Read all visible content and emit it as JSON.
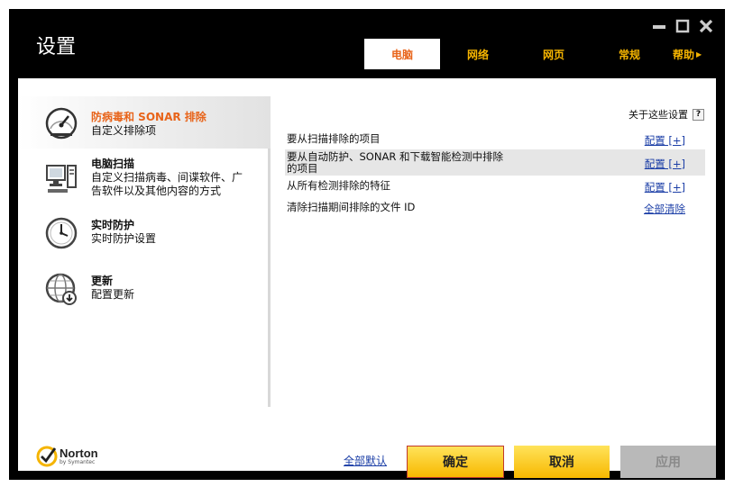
{
  "window": {
    "title": "设置",
    "controls": [
      "minimize-icon",
      "maximize-icon",
      "close-icon"
    ]
  },
  "tabs": [
    {
      "label": "电脑",
      "active": true
    },
    {
      "label": "网络",
      "active": false
    },
    {
      "label": "网页",
      "active": false
    },
    {
      "label": "常规",
      "active": false
    },
    {
      "label": "帮助",
      "active": false
    }
  ],
  "sidebar": {
    "items": [
      {
        "title": "防病毒和 SONAR 排除",
        "desc": "自定义排除项",
        "icon": "gauge-icon",
        "active": true
      },
      {
        "title": "电脑扫描",
        "desc": "自定义扫描病毒、间谍软件、广告软件以及其他内容的方式",
        "desc_line1": "自定义扫描病毒、间谍软件、广",
        "desc_line2": "告软件以及其他内容的方式",
        "icon": "computer-icon",
        "active": false
      },
      {
        "title": "实时防护",
        "desc": "实时防护设置",
        "icon": "clock-icon",
        "active": false
      },
      {
        "title": "更新",
        "desc": "配置更新",
        "icon": "globe-download-icon",
        "active": false
      }
    ]
  },
  "main": {
    "about_label": "关于这些设置",
    "help_label": "?",
    "rows": [
      {
        "label": "要从扫描排除的项目",
        "action": "配置 [+]"
      },
      {
        "label_line1": "要从自动防护、SONAR 和下载智能检测中排除",
        "label_line2": "的项目",
        "action": "配置 [+]"
      },
      {
        "label": "从所有检测排除的特征",
        "action": "配置 [+]"
      },
      {
        "label": "清除扫描期间排除的文件 ID",
        "action": "全部清除"
      }
    ]
  },
  "footer": {
    "logo_name": "Norton",
    "logo_sub": "by Symantec",
    "reset_label": "全部默认",
    "ok_label": "确定",
    "cancel_label": "取消",
    "apply_label": "应用"
  },
  "colors": {
    "accent_orange": "#e8641a",
    "tab_yellow": "#f5b400",
    "button_yellow": "#f7b800",
    "link_blue": "#1a3da6"
  }
}
